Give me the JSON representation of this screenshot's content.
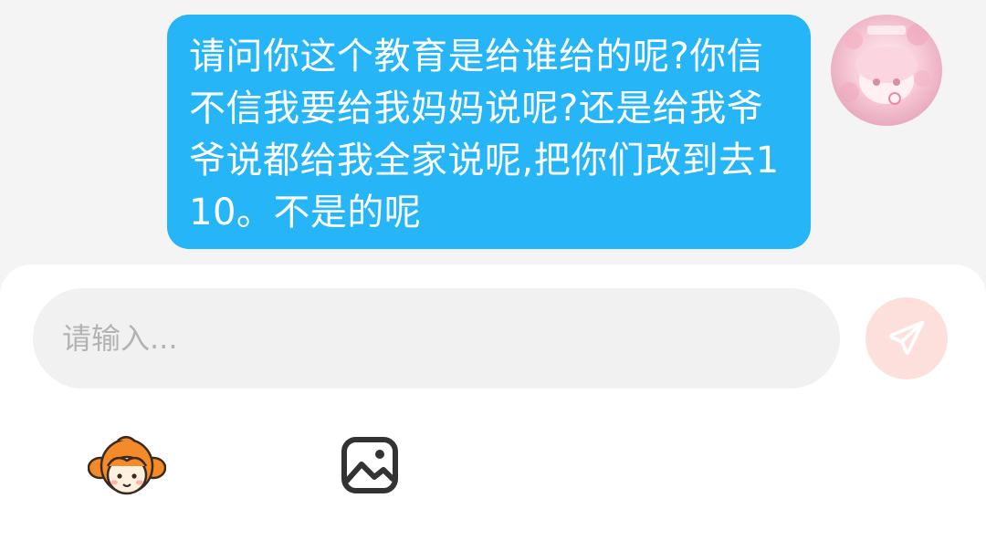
{
  "chat": {
    "messages": [
      {
        "sender": "self",
        "text": "请问你这个教育是给谁给的呢?你信不信我要给我妈妈说呢?还是给我爷爷说都给我全家说呢,把你们改到去110。不是的呢"
      }
    ]
  },
  "composer": {
    "placeholder": "请输入...",
    "value": ""
  },
  "icons": {
    "send": "paper-plane-icon",
    "emoji": "mascot-sticker-icon",
    "image": "image-icon",
    "avatar": "user-avatar"
  },
  "colors": {
    "bubble": "#26b5f7",
    "send_button_bg": "#fde0dc",
    "send_icon": "#ffffff"
  }
}
